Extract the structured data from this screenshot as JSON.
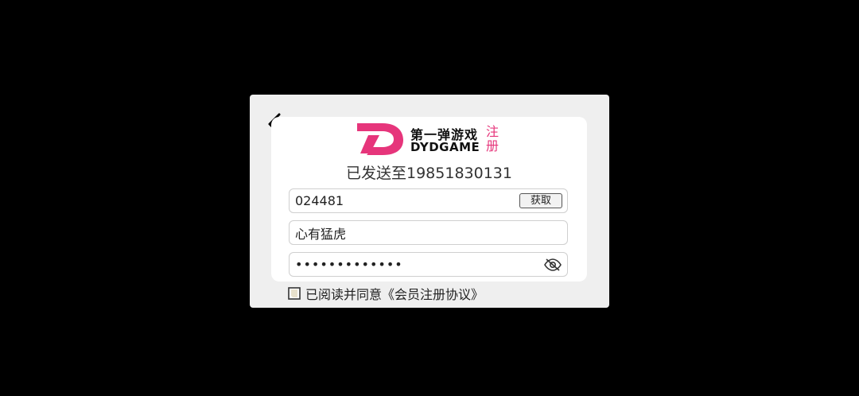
{
  "header": {
    "back_label": "back",
    "logo_cn": "第一弹游戏",
    "logo_en": "DYDGAME",
    "logo_register": "注册",
    "sent_to": "已发送至19851830131"
  },
  "form": {
    "code_value": "024481",
    "get_code_label": "获取",
    "nickname_value": "心有猛虎",
    "password_value": "•••••••••••••"
  },
  "agreement": {
    "prefix": "已阅读并同意",
    "link": "《会员注册协议》"
  },
  "colors": {
    "brand_pink": "#e6357b",
    "dialog_bg": "#efefef",
    "card_bg": "#ffffff",
    "backdrop": "#000000"
  },
  "icons": {
    "back": "arrow-left-icon",
    "password_toggle": "eye-slash-icon",
    "checkbox": "checkbox-icon"
  }
}
